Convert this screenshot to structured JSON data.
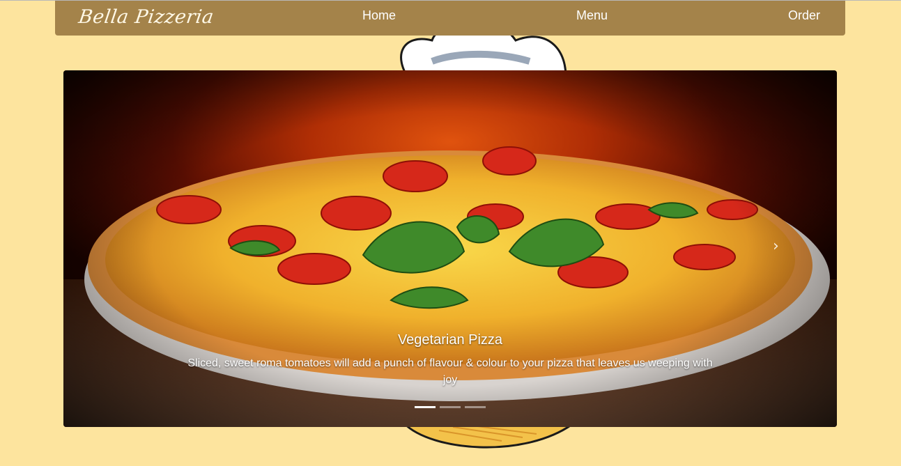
{
  "brand": {
    "name": "Bella Pizzeria"
  },
  "nav": {
    "items": [
      {
        "label": "Home"
      },
      {
        "label": "Menu"
      },
      {
        "label": "Order"
      }
    ]
  },
  "carousel": {
    "slides": [
      {
        "title": "Vegetarian Pizza",
        "text": "Sliced, sweet roma tomatoes will add a punch of flavour & colour to your pizza that leaves us weeping with joy",
        "active": true
      },
      {
        "active": false
      },
      {
        "active": false
      }
    ],
    "controls": {
      "prev_icon": "chevron-left-icon",
      "next_icon": "chevron-right-icon",
      "next_glyph": "›",
      "prev_glyph": "‹"
    }
  },
  "colors": {
    "page_background": "#fde49e",
    "navbar": "#a4834a",
    "nav_text": "#ffffff"
  }
}
